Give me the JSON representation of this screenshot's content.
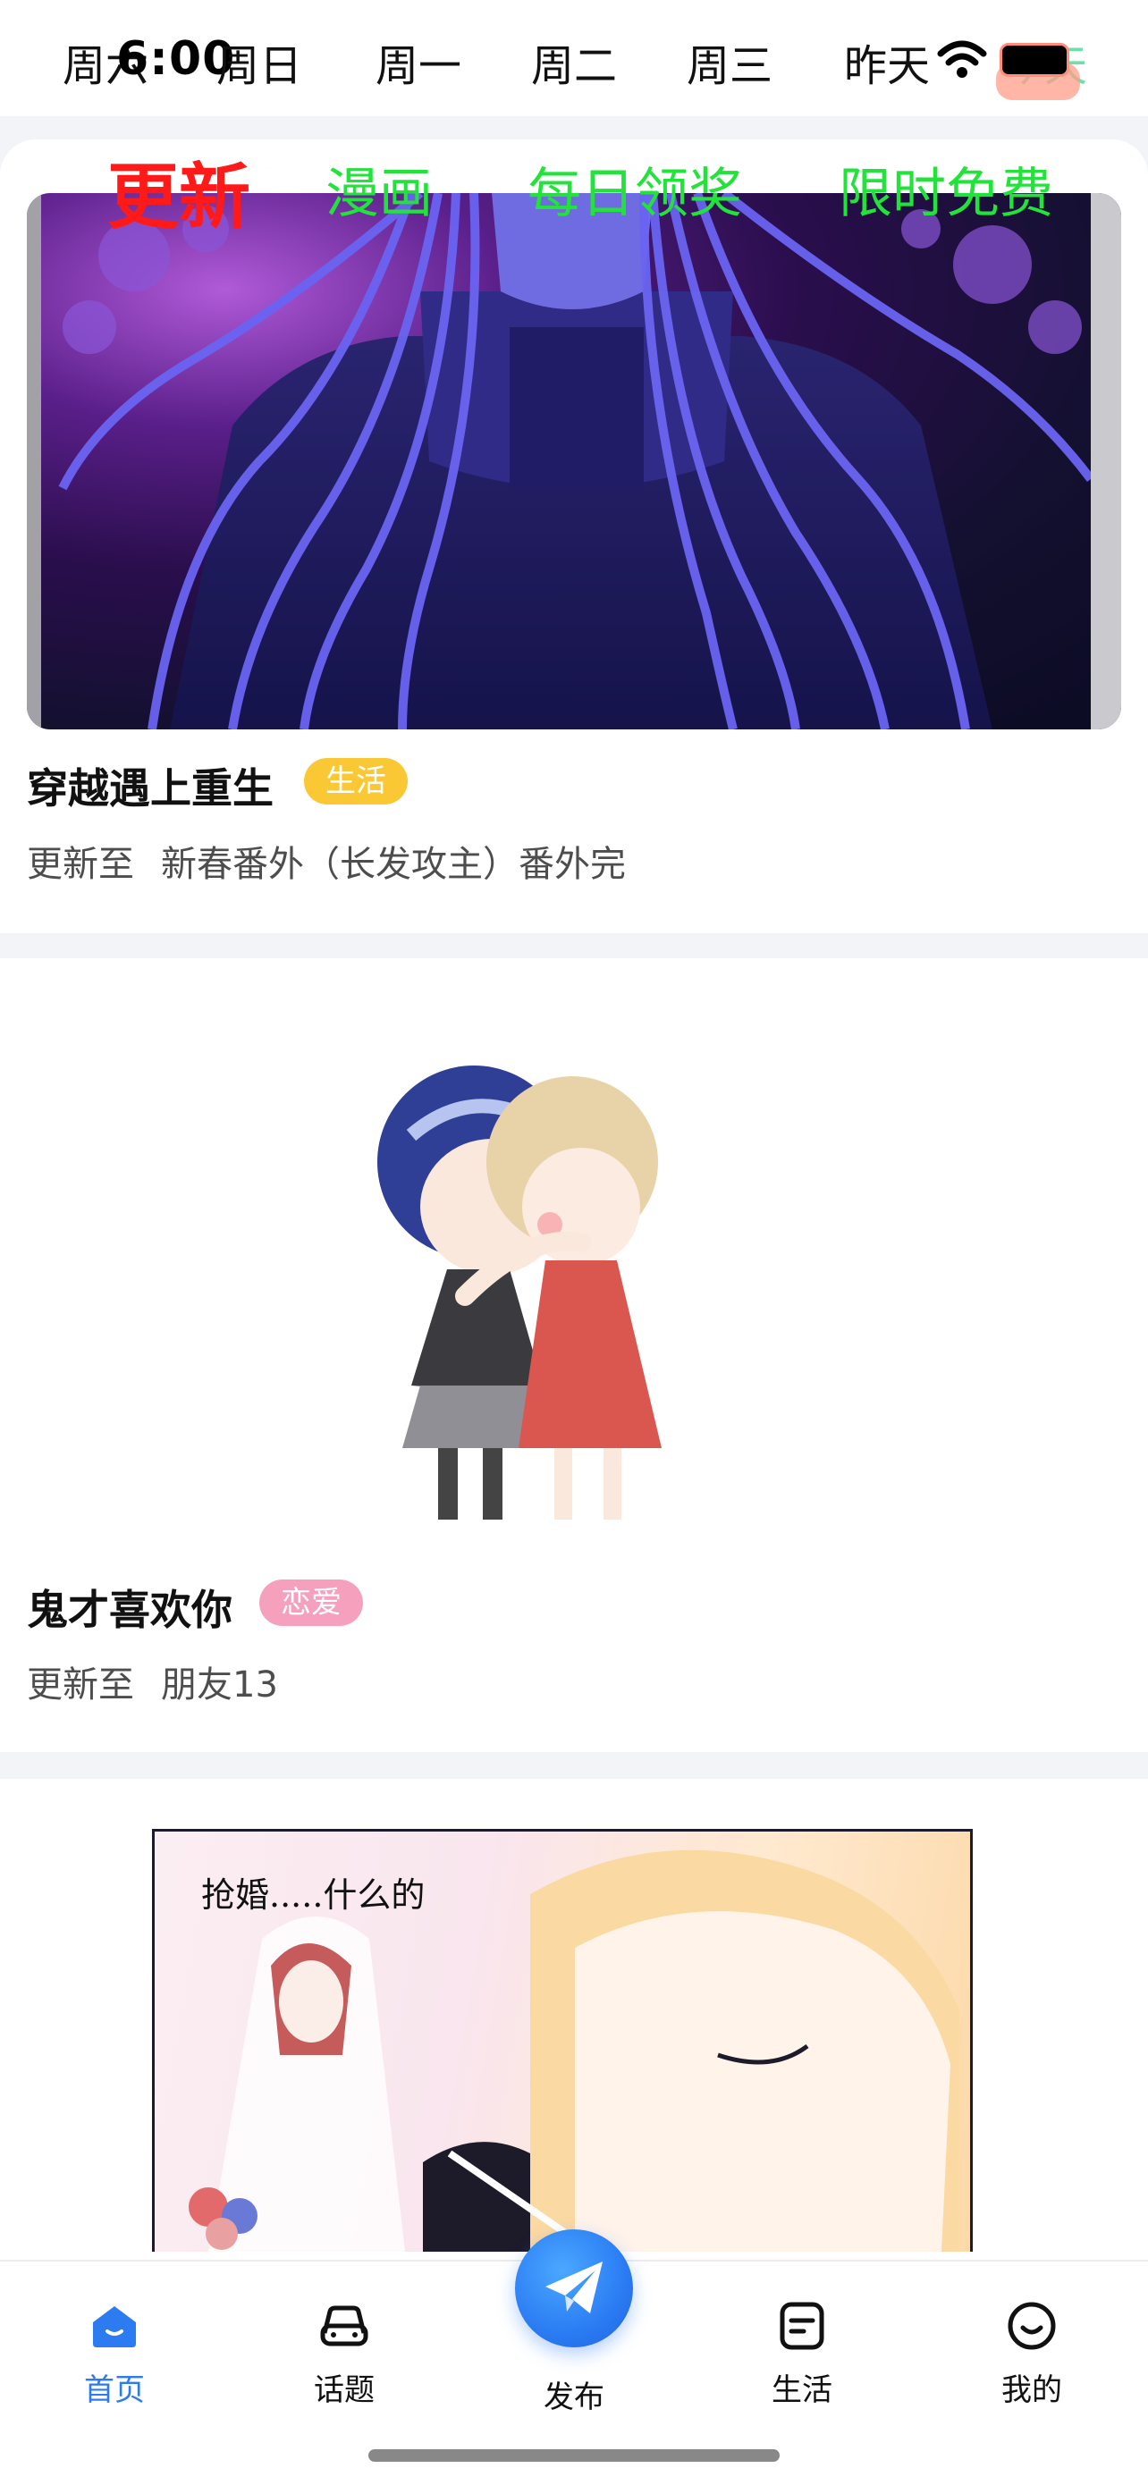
{
  "status_bar": {
    "time": "6:00"
  },
  "weekdays": [
    "周六",
    "周日",
    "周一",
    "周二",
    "周三",
    "昨天",
    "今天"
  ],
  "overlay_tabs": {
    "active": "更新",
    "items": [
      "漫画",
      "每日领奖",
      "限时免费"
    ]
  },
  "feed": [
    {
      "title": "穿越遇上重生",
      "tag": "生活",
      "update_prefix": "更新至",
      "update_text": "新春番外（长发攻主）番外完"
    },
    {
      "title": "鬼才喜欢你",
      "tag": "恋爱",
      "update_prefix": "更新至",
      "update_text": "朋友13"
    },
    {
      "cover_caption": "抢婚.....什么的"
    }
  ],
  "tabbar": {
    "home": "首页",
    "topics": "话题",
    "publish": "发布",
    "life": "生活",
    "mine": "我的"
  },
  "colors": {
    "accent": "#2d7bf0",
    "active_tab": "#ff1a1a",
    "overlay_green": "#22e33a",
    "tag_yellow": "#f9c834",
    "tag_pink": "#f5a1bd"
  }
}
